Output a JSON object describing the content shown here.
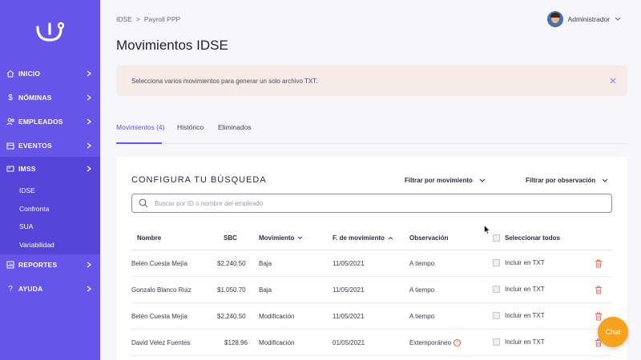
{
  "sidebar": {
    "items": [
      {
        "label": "INICIO",
        "icon": "home-icon"
      },
      {
        "label": "NÓMINAS",
        "icon": "dollar-icon"
      },
      {
        "label": "EMPLEADOS",
        "icon": "users-icon"
      },
      {
        "label": "EVENTOS",
        "icon": "calendar-icon"
      },
      {
        "label": "IMSS",
        "icon": "card-icon"
      },
      {
        "label": "REPORTES",
        "icon": "chart-icon"
      },
      {
        "label": "AYUDA",
        "icon": "help-icon"
      }
    ],
    "sub_items": [
      "IDSE",
      "Confronta",
      "SUA",
      "Variabilidad"
    ]
  },
  "header": {
    "breadcrumb": [
      "IDSE",
      ">",
      "Payroll PPP"
    ],
    "user_name": "Administrador",
    "page_title": "Movimientos IDSE"
  },
  "alert": {
    "text": "Selecciona varios movimientos para generar un solo archivo TXT."
  },
  "tabs": [
    "Movimientos (4)",
    "Histórico",
    "Eliminados"
  ],
  "search_card": {
    "title": "CONFIGURA TU BÚSQUEDA",
    "filter_movement": "Filtrar por movimiento",
    "filter_observation": "Filtrar por observación",
    "search_placeholder": "Buscar por ID o nombre del empleado"
  },
  "table": {
    "headers": {
      "name": "Nombre",
      "sbc": "SBC",
      "movement": "Movimiento",
      "date": "F. de movimiento",
      "observation": "Observación",
      "select_all": "Seleccionar todos"
    },
    "include_label": "Incluir en TXT",
    "rows": [
      {
        "name": "Belén Cuesta Mejía",
        "sbc": "$2,240.50",
        "movement": "Baja",
        "date": "11/05/2021",
        "observation": "A tiempo"
      },
      {
        "name": "Gonzalo Blanco Ruiz",
        "sbc": "$1,050.70",
        "movement": "Baja",
        "date": "11/05/2021",
        "observation": "A tiempo"
      },
      {
        "name": "Belén Cuesta Mejía",
        "sbc": "$2,240.50",
        "movement": "Modificación",
        "date": "11/05/2021",
        "observation": "A tiempo"
      },
      {
        "name": "David Velez Fuentes",
        "sbc": "$128.96",
        "movement": "Modificación",
        "date": "01/05/2021",
        "observation": "Extemporáneo"
      }
    ]
  },
  "chat_label": "Chat",
  "colors": {
    "sidebar": "#6655e8",
    "sidebar_active": "#5745d9",
    "accent": "#5f4fe0",
    "alert_bg": "#f6ebe7",
    "chat": "#f6a21c",
    "warning": "#e5533d"
  }
}
